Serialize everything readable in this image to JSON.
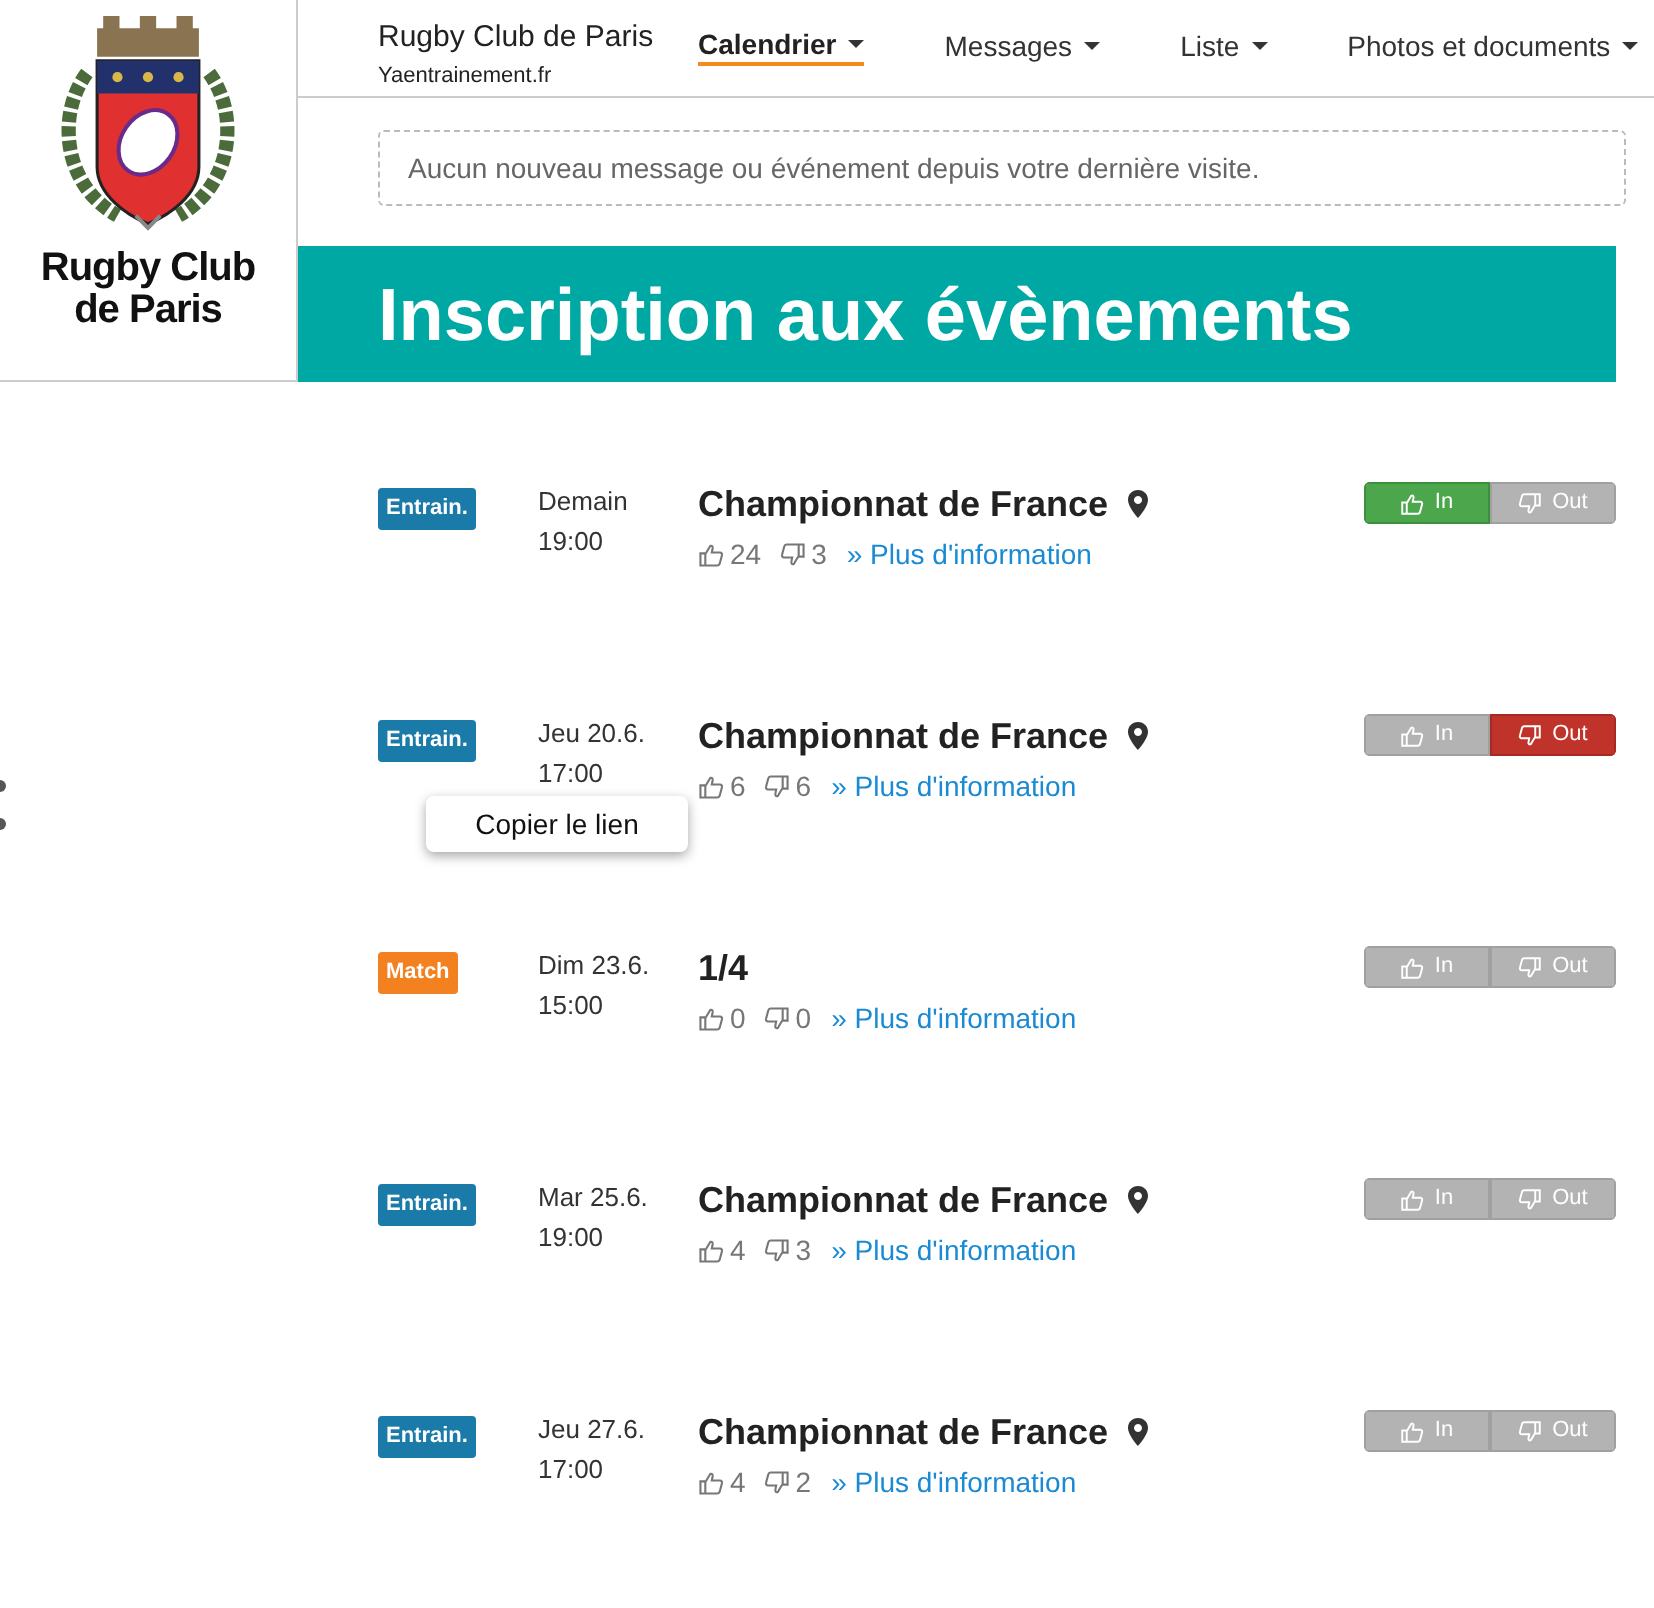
{
  "logo": {
    "text_line_1": "Rugby Club",
    "text_line_2": "de Paris"
  },
  "brand": {
    "name": "Rugby Club de Paris",
    "subtitle": "Yaentrainement.fr"
  },
  "nav": [
    {
      "label": "Calendrier",
      "selected": true
    },
    {
      "label": "Messages",
      "selected": false
    },
    {
      "label": "Liste",
      "selected": false
    },
    {
      "label": "Photos et documents",
      "selected": false
    }
  ],
  "notice": "Aucun nouveau message ou événement depuis votre dernière visite.",
  "banner": "Inscription aux évènements",
  "events": [
    {
      "kind": "training",
      "badge": "Entrain.",
      "date": "Demain",
      "time": "19:00",
      "title": "Championnat de France",
      "location": true,
      "likes": "24",
      "dislikes": "3",
      "link": "» Plus d'information",
      "buttons": [
        {
          "kind": "in",
          "label": "In",
          "selected": true
        },
        {
          "kind": "out",
          "label": "Out",
          "selected": false
        }
      ]
    },
    {
      "kind": "training",
      "badge": "Entrain.",
      "date": "Jeu 20.6.",
      "time": "17:00",
      "title": "Championnat de France",
      "location": true,
      "likes": "6",
      "dislikes": "6",
      "link": "» Plus d'information",
      "buttons": [
        {
          "kind": "in",
          "label": "In",
          "selected": false
        },
        {
          "kind": "out",
          "label": "Out",
          "selected": true
        }
      ]
    },
    {
      "kind": "match",
      "badge": "Match",
      "date": "Dim 23.6.",
      "time": "15:00",
      "title": "1/4",
      "location": false,
      "likes": "0",
      "dislikes": "0",
      "link": "» Plus d'information",
      "buttons": [
        {
          "kind": "in",
          "label": "In",
          "selected": false
        },
        {
          "kind": "out",
          "label": "Out",
          "selected": false
        }
      ]
    },
    {
      "kind": "training",
      "badge": "Entrain.",
      "date": "Mar 25.6.",
      "time": "19:00",
      "title": "Championnat de France",
      "location": true,
      "likes": "4",
      "dislikes": "3",
      "link": "» Plus d'information",
      "buttons": [
        {
          "kind": "in",
          "label": "In",
          "selected": false
        },
        {
          "kind": "out",
          "label": "Out",
          "selected": false
        }
      ]
    },
    {
      "kind": "training",
      "badge": "Entrain.",
      "date": "Jeu 27.6.",
      "time": "17:00",
      "title": "Championnat de France",
      "location": true,
      "likes": "4",
      "dislikes": "2",
      "link": "» Plus d'information",
      "buttons": [
        {
          "kind": "in",
          "label": "In",
          "selected": false
        },
        {
          "kind": "out",
          "label": "Out",
          "selected": false
        }
      ]
    }
  ],
  "context_menu": {
    "label": "Copier le lien"
  }
}
